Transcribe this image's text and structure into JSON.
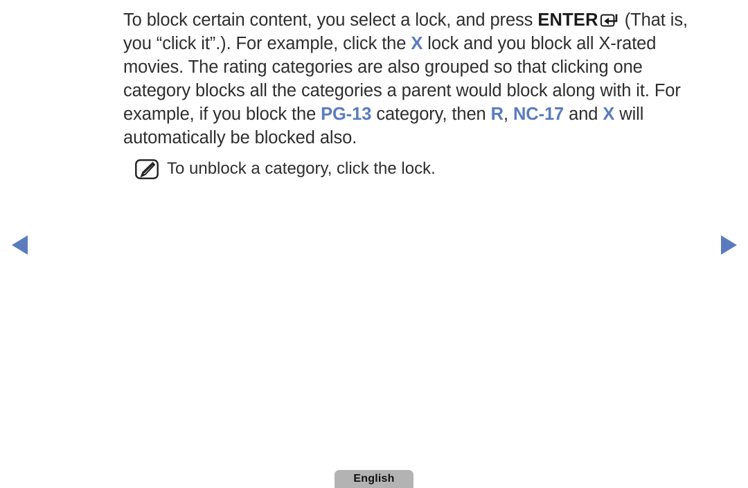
{
  "page": {
    "background_color": "#ffffff",
    "text_color": "#2e2e2e",
    "highlight_color": "#5a7cbe"
  },
  "body_text": {
    "segments": [
      {
        "text": "To block certain content, you select a lock, and press ",
        "style": "normal"
      },
      {
        "text": "ENTER",
        "style": "bold"
      },
      {
        "text": "enter-key-icon",
        "style": "icon"
      },
      {
        "text": " (That is, you “click it”.). For example, click the ",
        "style": "normal"
      },
      {
        "text": "X",
        "style": "highlight"
      },
      {
        "text": " lock and you block all X-rated movies. The rating categories are also grouped so that clicking one category blocks all the categories a parent would block along with it. For example, if you block the ",
        "style": "normal"
      },
      {
        "text": "PG-13",
        "style": "highlight"
      },
      {
        "text": " category, then ",
        "style": "normal"
      },
      {
        "text": "R",
        "style": "highlight"
      },
      {
        "text": ", ",
        "style": "normal"
      },
      {
        "text": "NC-17",
        "style": "highlight"
      },
      {
        "text": " and ",
        "style": "normal"
      },
      {
        "text": "X",
        "style": "highlight"
      },
      {
        "text": " will automatically be blocked also.",
        "style": "normal"
      }
    ],
    "part1": "To block certain content, you select a lock, and press ",
    "enter_label": "ENTER",
    "part2": " (That is, you “click it”.). For example, click the ",
    "rating_x1": "X",
    "part3": " lock and you block all X-rated movies. The rating categories are also grouped so that clicking one category blocks all the categories a parent would block along with it. For example, if you block the ",
    "rating_pg13": "PG-13",
    "part4": " category, then ",
    "rating_r": "R",
    "part5": ", ",
    "rating_nc17": "NC-17",
    "part6": " and ",
    "rating_x2": "X",
    "part7": " will automatically be blocked also."
  },
  "note": {
    "icon": "note-pencil-icon",
    "text": "To unblock a category, click the lock."
  },
  "navigation": {
    "prev": "previous-page-arrow",
    "next": "next-page-arrow",
    "arrow_color": "#5a7cbe"
  },
  "language_button": {
    "label": "English",
    "background_color": "#b3b3b3"
  }
}
